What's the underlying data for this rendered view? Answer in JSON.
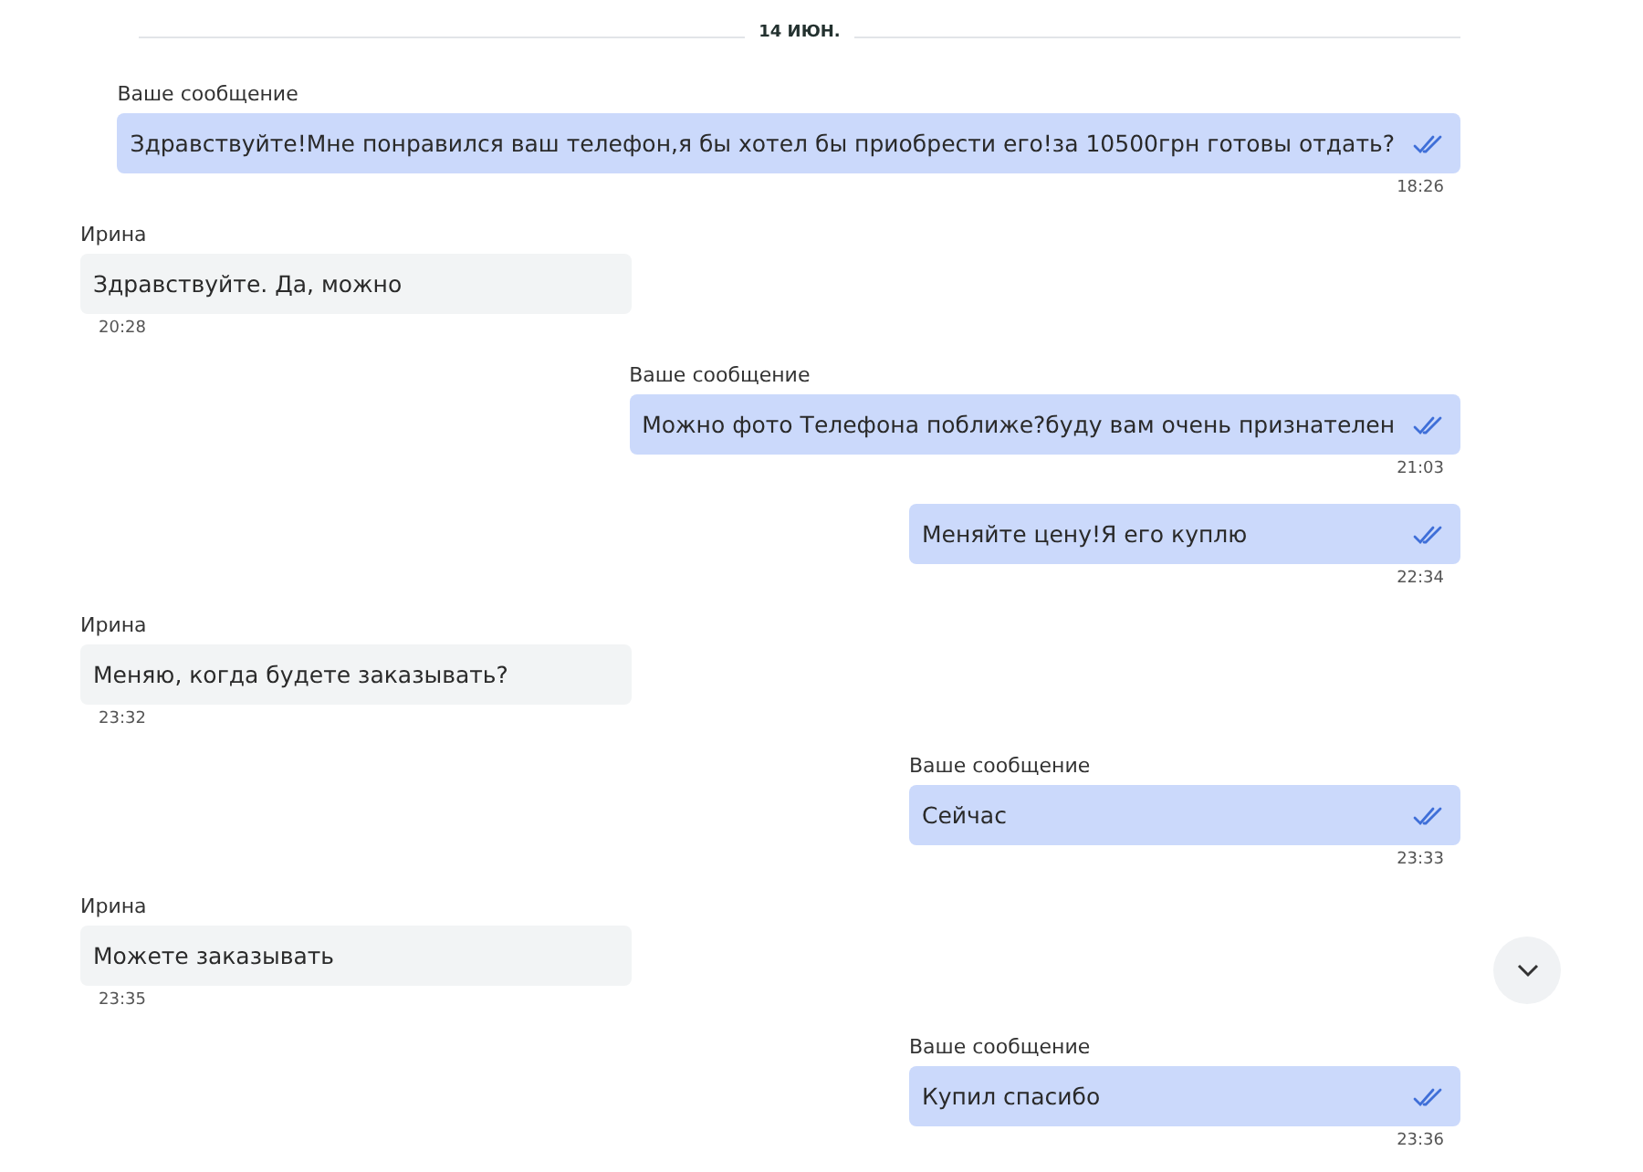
{
  "date_divider": "14 ИЮН.",
  "messages": [
    {
      "kind": "outgoing",
      "sender": "Ваше сообщение",
      "text": "Здравствуйте!Мне понравился ваш телефон,я бы хотел бы приобрести его!за 10500грн готовы отдать?",
      "time": "18:26",
      "read": true
    },
    {
      "kind": "incoming",
      "sender": "Ирина",
      "text": "Здравствуйте. Да, можно",
      "time": "20:28"
    },
    {
      "kind": "outgoing",
      "sender": "Ваше сообщение",
      "text": "Можно фото Телефона поближе?буду вам очень признателен",
      "time": "21:03",
      "read": true
    },
    {
      "kind": "outgoing",
      "text": "Меняйте цену!Я его куплю",
      "time": "22:34",
      "read": true
    },
    {
      "kind": "incoming",
      "sender": "Ирина",
      "text": "Меняю, когда будете заказывать?",
      "time": "23:32"
    },
    {
      "kind": "outgoing",
      "sender": "Ваше сообщение",
      "text": "Сейчас",
      "time": "23:33",
      "read": true
    },
    {
      "kind": "incoming",
      "sender": "Ирина",
      "text": "Можете заказывать",
      "time": "23:35"
    },
    {
      "kind": "outgoing",
      "sender": "Ваше сообщение",
      "text": "Купил спасибо",
      "time": "23:36",
      "read": true
    }
  ]
}
